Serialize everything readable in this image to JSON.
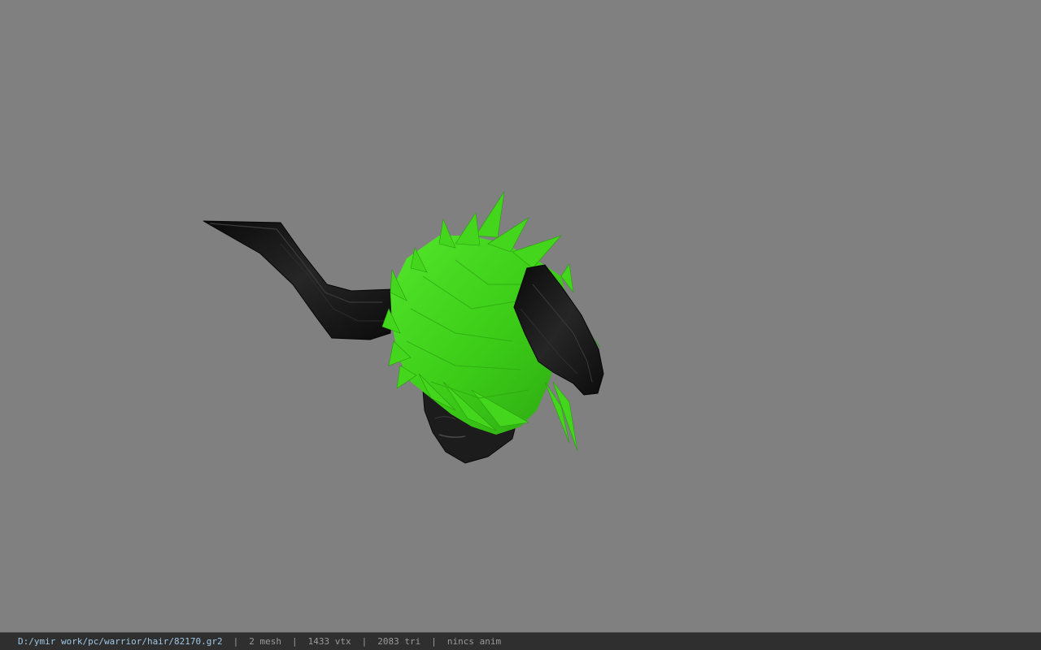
{
  "viewport": {
    "background_color": "#808080",
    "model": {
      "hair_color": "#3fd11a",
      "horn_color": "#101010",
      "face_color": "#1c1c1c"
    }
  },
  "statusbar": {
    "path": "D:/ymir work/pc/warrior/hair/82170.gr2",
    "mesh": "2 mesh",
    "vtx": "1433 vtx",
    "tri": "2083 tri",
    "anim": "nincs anim",
    "separator": "|",
    "colors": {
      "background": "#2f2f2f",
      "path_text": "#9fc7e6",
      "text": "#9a9a9a"
    }
  }
}
